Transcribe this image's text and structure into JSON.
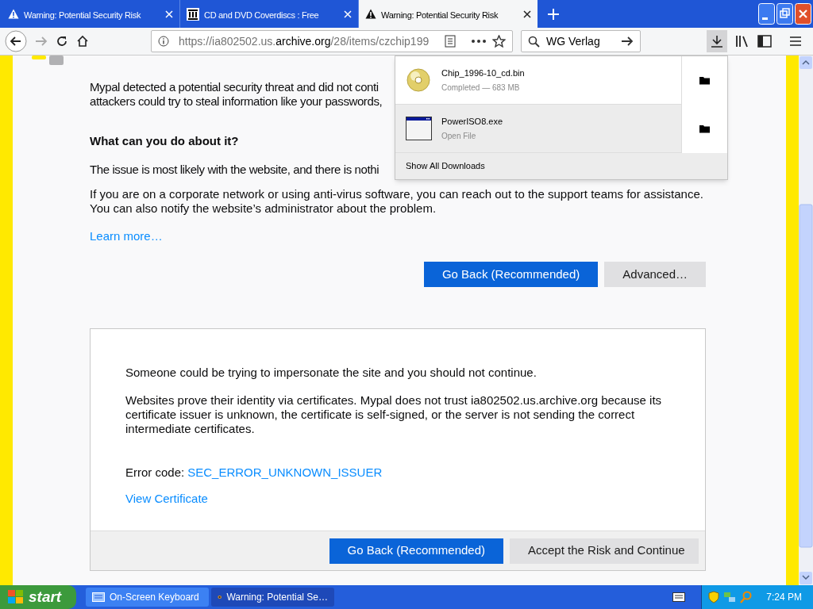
{
  "tabs": [
    {
      "kind": "warning",
      "label": "Warning: Potential Security Risk",
      "selected": false
    },
    {
      "kind": "archive",
      "label": "CD and DVD Coverdiscs : Free",
      "selected": false
    },
    {
      "kind": "warning",
      "label": "Warning: Potential Security Risk",
      "selected": true
    }
  ],
  "url": {
    "prefix": "https://ia802502.us.",
    "domain": "archive.org",
    "path": "/28/items/czchip199"
  },
  "search": {
    "value": "WG Verlag"
  },
  "page": {
    "intro_lines": [
      "Mypal detected a potential security threat and did not conti",
      "attackers could try to steal information like your passwords,"
    ],
    "heading": "What can you do about it?",
    "paragraphs": [
      [
        "The issue is most likely with the website, and there is nothi"
      ],
      [
        "If you are on a corporate network or using anti-virus software, you can reach out to the support teams for assistance.",
        "You can also notify the website’s administrator about the problem."
      ]
    ],
    "learn_more": "Learn more…",
    "buttons": [
      "Go Back (Recommended)",
      "Advanced…"
    ],
    "advanced": {
      "lead": "Someone could be trying to impersonate the site and you should not continue.",
      "detail": "Websites prove their identity via certificates. Mypal does not trust ia802502.us.archive.org because its certificate issuer is unknown, the certificate is self-signed, or the server is not sending the correct intermediate certificates.",
      "error_label": "Error code:",
      "error_code": "SEC_ERROR_UNKNOWN_ISSUER",
      "view_certificate": "View Certificate",
      "buttons": [
        "Go Back (Recommended)",
        "Accept the Risk and Continue"
      ]
    }
  },
  "downloads": {
    "items": [
      {
        "kind": "disc",
        "name": "Chip_1996-10_cd.bin",
        "status": "Completed — 683 MB",
        "highlighted": false
      },
      {
        "kind": "program",
        "name": "PowerISO8.exe",
        "status": "Open File",
        "highlighted": true
      }
    ],
    "show_all": "Show All Downloads"
  },
  "taskbar": {
    "start": "start",
    "items": [
      {
        "kind": "keyboard",
        "label": "On-Screen Keyboard",
        "selected": false
      },
      {
        "kind": "browser",
        "label": "Warning: Potential Se…",
        "selected": true
      }
    ],
    "clock": "7:24 PM"
  }
}
